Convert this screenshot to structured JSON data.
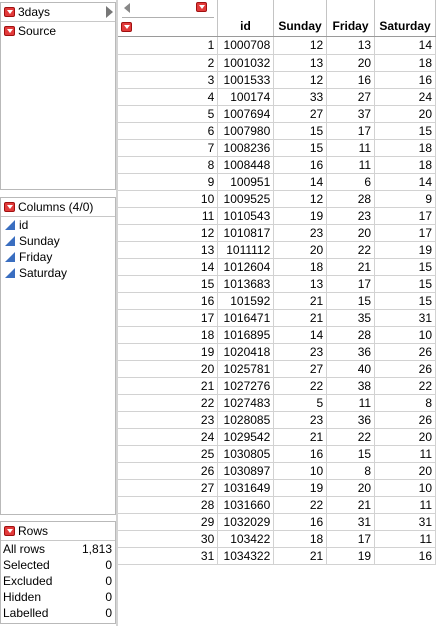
{
  "table_panel": {
    "name": "3days",
    "source_label": "Source"
  },
  "columns_panel": {
    "title": "Columns (4/0)",
    "items": [
      "id",
      "Sunday",
      "Friday",
      "Saturday"
    ]
  },
  "rows_panel": {
    "title": "Rows",
    "stats": [
      {
        "label": "All rows",
        "value": "1,813"
      },
      {
        "label": "Selected",
        "value": "0"
      },
      {
        "label": "Excluded",
        "value": "0"
      },
      {
        "label": "Hidden",
        "value": "0"
      },
      {
        "label": "Labelled",
        "value": "0"
      }
    ]
  },
  "grid": {
    "headers": [
      "id",
      "Sunday",
      "Friday",
      "Saturday"
    ],
    "rows": [
      [
        "1",
        "1000708",
        "12",
        "13",
        "14"
      ],
      [
        "2",
        "1001032",
        "13",
        "20",
        "18"
      ],
      [
        "3",
        "1001533",
        "12",
        "16",
        "16"
      ],
      [
        "4",
        "100174",
        "33",
        "27",
        "24"
      ],
      [
        "5",
        "1007694",
        "27",
        "37",
        "20"
      ],
      [
        "6",
        "1007980",
        "15",
        "17",
        "15"
      ],
      [
        "7",
        "1008236",
        "15",
        "11",
        "18"
      ],
      [
        "8",
        "1008448",
        "16",
        "11",
        "18"
      ],
      [
        "9",
        "100951",
        "14",
        "6",
        "14"
      ],
      [
        "10",
        "1009525",
        "12",
        "28",
        "9"
      ],
      [
        "11",
        "1010543",
        "19",
        "23",
        "17"
      ],
      [
        "12",
        "1010817",
        "23",
        "20",
        "17"
      ],
      [
        "13",
        "1011112",
        "20",
        "22",
        "19"
      ],
      [
        "14",
        "1012604",
        "18",
        "21",
        "15"
      ],
      [
        "15",
        "1013683",
        "13",
        "17",
        "15"
      ],
      [
        "16",
        "101592",
        "21",
        "15",
        "15"
      ],
      [
        "17",
        "1016471",
        "21",
        "35",
        "31"
      ],
      [
        "18",
        "1016895",
        "14",
        "28",
        "10"
      ],
      [
        "19",
        "1020418",
        "23",
        "36",
        "26"
      ],
      [
        "20",
        "1025781",
        "27",
        "40",
        "26"
      ],
      [
        "21",
        "1027276",
        "22",
        "38",
        "22"
      ],
      [
        "22",
        "1027483",
        "5",
        "11",
        "8"
      ],
      [
        "23",
        "1028085",
        "23",
        "36",
        "26"
      ],
      [
        "24",
        "1029542",
        "21",
        "22",
        "20"
      ],
      [
        "25",
        "1030805",
        "16",
        "15",
        "11"
      ],
      [
        "26",
        "1030897",
        "10",
        "8",
        "20"
      ],
      [
        "27",
        "1031649",
        "19",
        "20",
        "10"
      ],
      [
        "28",
        "1031660",
        "22",
        "21",
        "11"
      ],
      [
        "29",
        "1032029",
        "16",
        "31",
        "31"
      ],
      [
        "30",
        "103422",
        "18",
        "17",
        "11"
      ],
      [
        "31",
        "1034322",
        "21",
        "19",
        "16"
      ]
    ]
  },
  "colors": {
    "accent_red": "#e23a3a",
    "column_icon_blue": "#3a6ec0"
  }
}
